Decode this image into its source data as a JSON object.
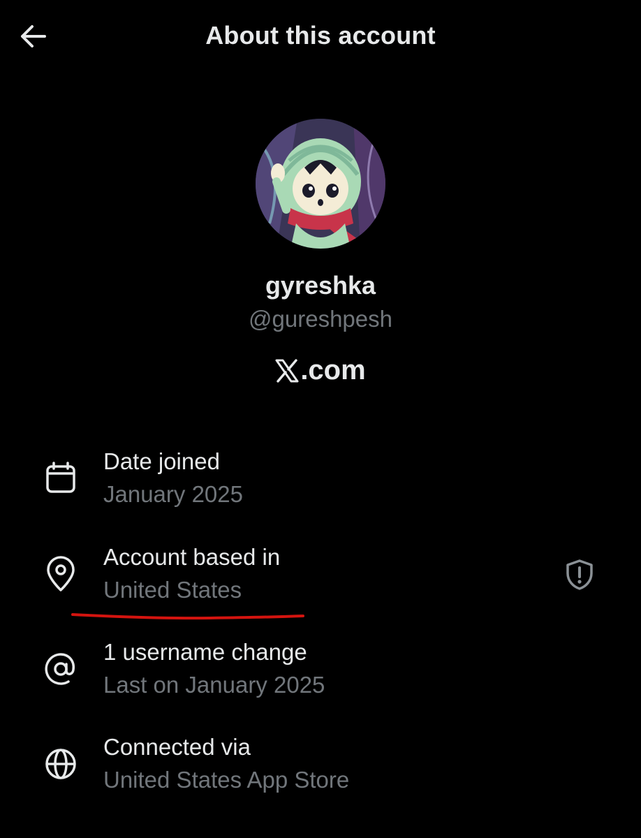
{
  "header": {
    "title": "About this account",
    "back_icon": "arrow-left-icon"
  },
  "profile": {
    "display_name": "gyreshka",
    "handle": "@gureshpesh",
    "brand_text": ".com",
    "brand_logo": "x-logo-icon"
  },
  "details": [
    {
      "title": "Date joined",
      "value": "January 2025",
      "icon": "calendar-icon"
    },
    {
      "title": "Account based in",
      "value": "United States",
      "icon": "location-pin-icon",
      "action_icon": "shield-alert-icon"
    },
    {
      "title": "1 username change",
      "value": "Last on January 2025",
      "icon": "at-sign-icon"
    },
    {
      "title": "Connected via",
      "value": "United States App Store",
      "icon": "globe-icon"
    }
  ],
  "colors": {
    "background": "#000000",
    "primary_text": "#e7e9ea",
    "secondary_text": "#71767b",
    "annotation": "#d4140f"
  }
}
